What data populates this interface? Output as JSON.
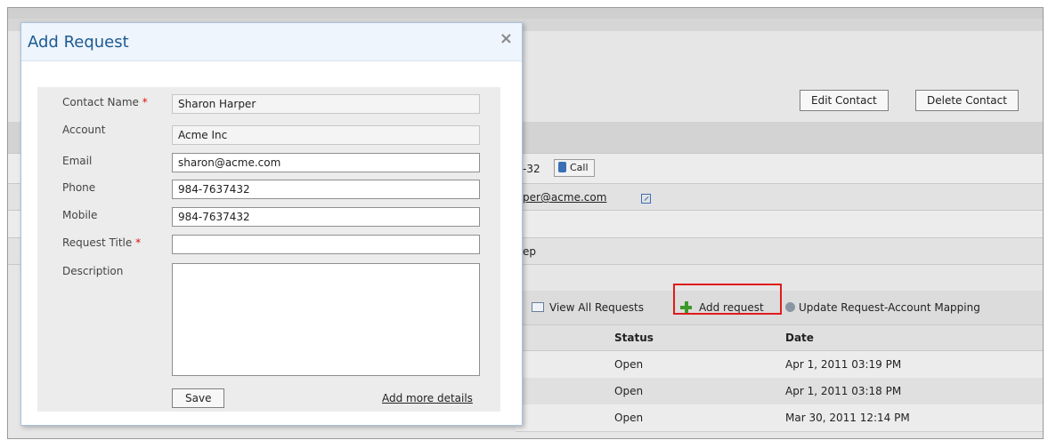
{
  "modal": {
    "title": "Add Request",
    "close_icon": "×",
    "fields": {
      "contact_name": {
        "label": "Contact Name",
        "value": "Sharon Harper"
      },
      "account": {
        "label": "Account",
        "value": "Acme Inc"
      },
      "email": {
        "label": "Email",
        "value": "sharon@acme.com"
      },
      "phone": {
        "label": "Phone",
        "value": "984-7637432"
      },
      "mobile": {
        "label": "Mobile",
        "value": "984-7637432"
      },
      "request_title": {
        "label": "Request Title",
        "value": ""
      },
      "description": {
        "label": "Description",
        "value": ""
      }
    },
    "required_marker": "*",
    "save_label": "Save",
    "more_details_label": "Add more details"
  },
  "background": {
    "edit_contact_label": "Edit Contact",
    "delete_contact_label": "Delete Contact",
    "phone_fragment": "-32",
    "call_label": "Call",
    "email_fragment": "per@acme.com",
    "partial_text": "ep",
    "requests_toolbar": {
      "view_all": "View All Requests",
      "add_request": "Add request",
      "update_mapping": "Update Request-Account Mapping"
    },
    "table": {
      "columns": [
        "Status",
        "Date"
      ],
      "rows": [
        {
          "status": "Open",
          "date": "Apr 1, 2011 03:19 PM"
        },
        {
          "status": "Open",
          "date": "Apr 1, 2011 03:18 PM"
        },
        {
          "status": "Open",
          "date": "Mar 30, 2011 12:14 PM"
        }
      ]
    }
  },
  "colors": {
    "modal_title": "#1c5a92",
    "highlight": "#e01b1b",
    "add_icon": "#3c9a2a"
  }
}
